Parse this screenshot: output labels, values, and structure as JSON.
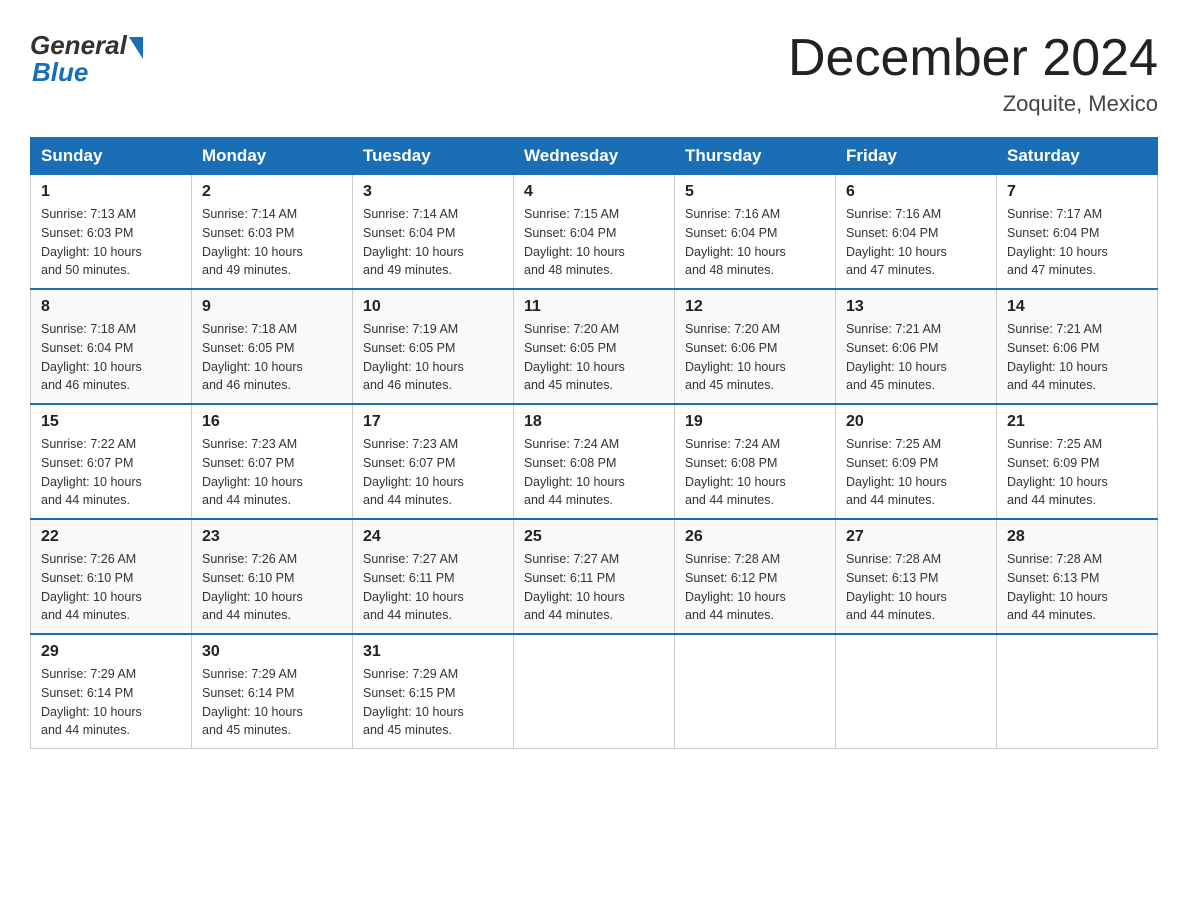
{
  "logo": {
    "general": "General",
    "blue": "Blue"
  },
  "title": "December 2024",
  "location": "Zoquite, Mexico",
  "days_of_week": [
    "Sunday",
    "Monday",
    "Tuesday",
    "Wednesday",
    "Thursday",
    "Friday",
    "Saturday"
  ],
  "weeks": [
    [
      {
        "day": "1",
        "sunrise": "7:13 AM",
        "sunset": "6:03 PM",
        "daylight": "10 hours and 50 minutes."
      },
      {
        "day": "2",
        "sunrise": "7:14 AM",
        "sunset": "6:03 PM",
        "daylight": "10 hours and 49 minutes."
      },
      {
        "day": "3",
        "sunrise": "7:14 AM",
        "sunset": "6:04 PM",
        "daylight": "10 hours and 49 minutes."
      },
      {
        "day": "4",
        "sunrise": "7:15 AM",
        "sunset": "6:04 PM",
        "daylight": "10 hours and 48 minutes."
      },
      {
        "day": "5",
        "sunrise": "7:16 AM",
        "sunset": "6:04 PM",
        "daylight": "10 hours and 48 minutes."
      },
      {
        "day": "6",
        "sunrise": "7:16 AM",
        "sunset": "6:04 PM",
        "daylight": "10 hours and 47 minutes."
      },
      {
        "day": "7",
        "sunrise": "7:17 AM",
        "sunset": "6:04 PM",
        "daylight": "10 hours and 47 minutes."
      }
    ],
    [
      {
        "day": "8",
        "sunrise": "7:18 AM",
        "sunset": "6:04 PM",
        "daylight": "10 hours and 46 minutes."
      },
      {
        "day": "9",
        "sunrise": "7:18 AM",
        "sunset": "6:05 PM",
        "daylight": "10 hours and 46 minutes."
      },
      {
        "day": "10",
        "sunrise": "7:19 AM",
        "sunset": "6:05 PM",
        "daylight": "10 hours and 46 minutes."
      },
      {
        "day": "11",
        "sunrise": "7:20 AM",
        "sunset": "6:05 PM",
        "daylight": "10 hours and 45 minutes."
      },
      {
        "day": "12",
        "sunrise": "7:20 AM",
        "sunset": "6:06 PM",
        "daylight": "10 hours and 45 minutes."
      },
      {
        "day": "13",
        "sunrise": "7:21 AM",
        "sunset": "6:06 PM",
        "daylight": "10 hours and 45 minutes."
      },
      {
        "day": "14",
        "sunrise": "7:21 AM",
        "sunset": "6:06 PM",
        "daylight": "10 hours and 44 minutes."
      }
    ],
    [
      {
        "day": "15",
        "sunrise": "7:22 AM",
        "sunset": "6:07 PM",
        "daylight": "10 hours and 44 minutes."
      },
      {
        "day": "16",
        "sunrise": "7:23 AM",
        "sunset": "6:07 PM",
        "daylight": "10 hours and 44 minutes."
      },
      {
        "day": "17",
        "sunrise": "7:23 AM",
        "sunset": "6:07 PM",
        "daylight": "10 hours and 44 minutes."
      },
      {
        "day": "18",
        "sunrise": "7:24 AM",
        "sunset": "6:08 PM",
        "daylight": "10 hours and 44 minutes."
      },
      {
        "day": "19",
        "sunrise": "7:24 AM",
        "sunset": "6:08 PM",
        "daylight": "10 hours and 44 minutes."
      },
      {
        "day": "20",
        "sunrise": "7:25 AM",
        "sunset": "6:09 PM",
        "daylight": "10 hours and 44 minutes."
      },
      {
        "day": "21",
        "sunrise": "7:25 AM",
        "sunset": "6:09 PM",
        "daylight": "10 hours and 44 minutes."
      }
    ],
    [
      {
        "day": "22",
        "sunrise": "7:26 AM",
        "sunset": "6:10 PM",
        "daylight": "10 hours and 44 minutes."
      },
      {
        "day": "23",
        "sunrise": "7:26 AM",
        "sunset": "6:10 PM",
        "daylight": "10 hours and 44 minutes."
      },
      {
        "day": "24",
        "sunrise": "7:27 AM",
        "sunset": "6:11 PM",
        "daylight": "10 hours and 44 minutes."
      },
      {
        "day": "25",
        "sunrise": "7:27 AM",
        "sunset": "6:11 PM",
        "daylight": "10 hours and 44 minutes."
      },
      {
        "day": "26",
        "sunrise": "7:28 AM",
        "sunset": "6:12 PM",
        "daylight": "10 hours and 44 minutes."
      },
      {
        "day": "27",
        "sunrise": "7:28 AM",
        "sunset": "6:13 PM",
        "daylight": "10 hours and 44 minutes."
      },
      {
        "day": "28",
        "sunrise": "7:28 AM",
        "sunset": "6:13 PM",
        "daylight": "10 hours and 44 minutes."
      }
    ],
    [
      {
        "day": "29",
        "sunrise": "7:29 AM",
        "sunset": "6:14 PM",
        "daylight": "10 hours and 44 minutes."
      },
      {
        "day": "30",
        "sunrise": "7:29 AM",
        "sunset": "6:14 PM",
        "daylight": "10 hours and 45 minutes."
      },
      {
        "day": "31",
        "sunrise": "7:29 AM",
        "sunset": "6:15 PM",
        "daylight": "10 hours and 45 minutes."
      },
      null,
      null,
      null,
      null
    ]
  ],
  "labels": {
    "sunrise": "Sunrise:",
    "sunset": "Sunset:",
    "daylight": "Daylight:"
  }
}
